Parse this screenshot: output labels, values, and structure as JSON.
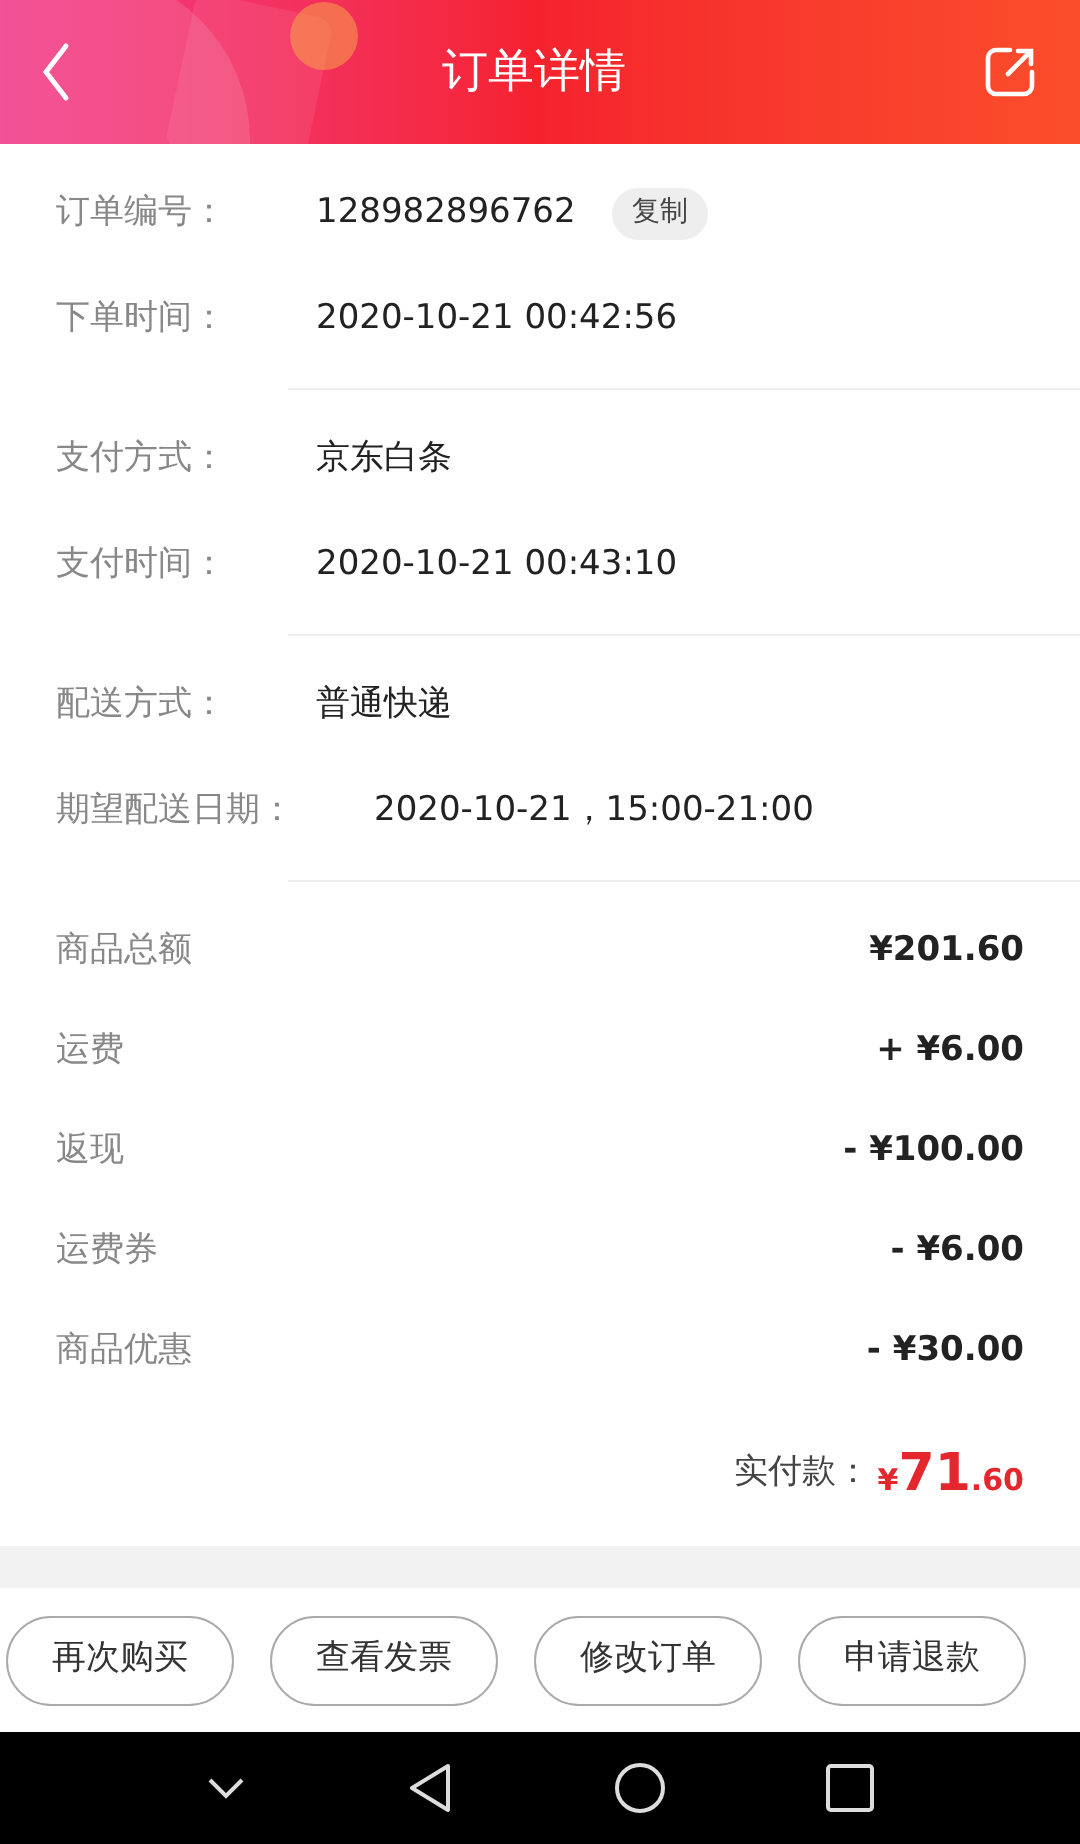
{
  "header": {
    "title": "订单详情"
  },
  "info_sections": [
    [
      {
        "label": "订单编号：",
        "value": "128982896762",
        "action": "复制"
      },
      {
        "label": "下单时间：",
        "value": "2020-10-21 00:42:56"
      }
    ],
    [
      {
        "label": "支付方式：",
        "value": "京东白条"
      },
      {
        "label": "支付时间：",
        "value": "2020-10-21 00:43:10"
      }
    ],
    [
      {
        "label": "配送方式：",
        "value": "普通快递"
      },
      {
        "label": "期望配送日期：",
        "value": "2020-10-21，15:00-21:00"
      }
    ]
  ],
  "price_rows": [
    {
      "label": "商品总额",
      "value": "¥201.60"
    },
    {
      "label": "运费",
      "value": "+ ¥6.00"
    },
    {
      "label": "返现",
      "value": "- ¥100.00"
    },
    {
      "label": "运费券",
      "value": "- ¥6.00"
    },
    {
      "label": "商品优惠",
      "value": "- ¥30.00"
    }
  ],
  "total": {
    "label": "实付款：",
    "currency": "¥",
    "integer": "71",
    "decimal": ".60"
  },
  "actions": [
    "再次购买",
    "查看发票",
    "修改订单",
    "申请退款"
  ]
}
